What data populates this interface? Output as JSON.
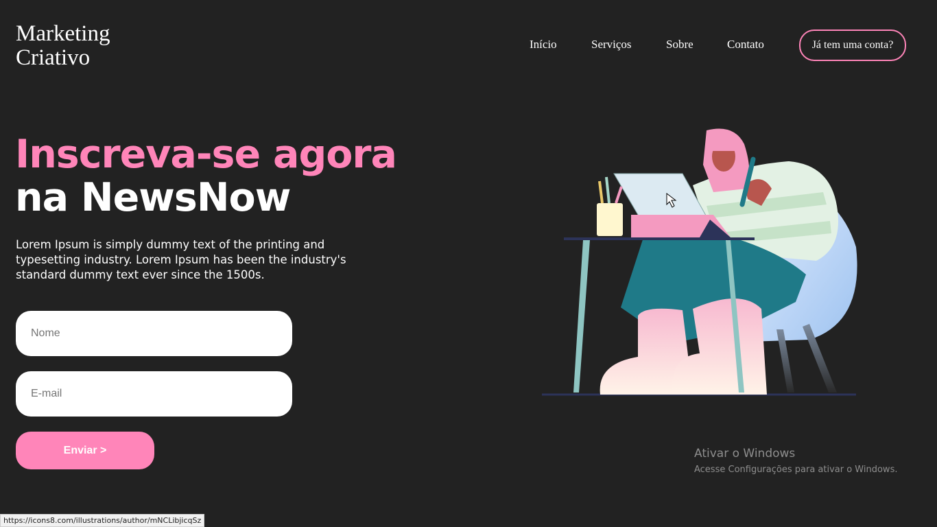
{
  "logo": {
    "line1": "Marketing",
    "line2": "Criativo"
  },
  "nav": {
    "items": [
      {
        "label": "Início"
      },
      {
        "label": "Serviços"
      },
      {
        "label": "Sobre"
      },
      {
        "label": "Contato"
      }
    ],
    "login_label": "Já tem uma conta?"
  },
  "hero": {
    "title_line1": "Inscreva-se agora",
    "title_line2": "na NewsNow",
    "description": "Lorem Ipsum is simply dummy text of the printing and typesetting industry. Lorem Ipsum has been the industry's standard dummy text ever since the 1500s."
  },
  "form": {
    "name_placeholder": "Nome",
    "email_placeholder": "E-mail",
    "submit_label": "Enviar >"
  },
  "windows_watermark": {
    "title": "Ativar o Windows",
    "subtitle": "Acesse Configurações para ativar o Windows."
  },
  "status_bar": {
    "url": "https://icons8.com/illustrations/author/mNCLibjicqSz"
  },
  "colors": {
    "background": "#222222",
    "accent": "#ff85b9",
    "text": "#ffffff"
  },
  "icons": {
    "illustration": "woman-at-laptop-illustration",
    "cursor": "hand-pointer-icon"
  }
}
